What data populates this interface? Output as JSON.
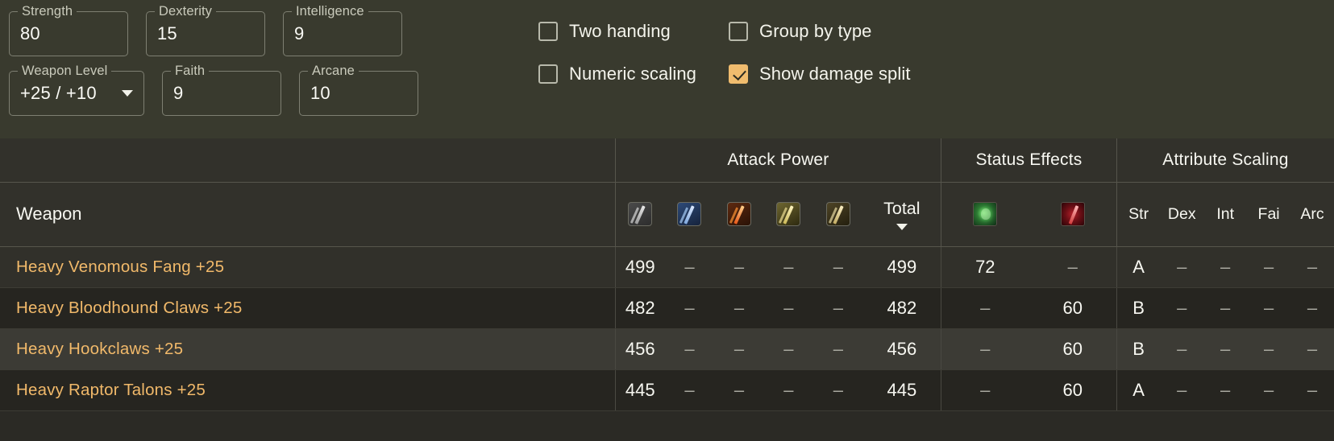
{
  "controls": {
    "fields": [
      {
        "name": "strength",
        "label": "Strength",
        "value": "80",
        "dropdown": false
      },
      {
        "name": "dexterity",
        "label": "Dexterity",
        "value": "15",
        "dropdown": false
      },
      {
        "name": "intelligence",
        "label": "Intelligence",
        "value": "9",
        "dropdown": false
      },
      {
        "name": "weapon-level",
        "label": "Weapon Level",
        "value": "+25 / +10",
        "dropdown": true
      },
      {
        "name": "faith",
        "label": "Faith",
        "value": "9",
        "dropdown": false
      },
      {
        "name": "arcane",
        "label": "Arcane",
        "value": "10",
        "dropdown": false
      }
    ],
    "checkboxes": [
      {
        "name": "two-handing",
        "label": "Two handing",
        "checked": false
      },
      {
        "name": "group-by-type",
        "label": "Group by type",
        "checked": false
      },
      {
        "name": "numeric-scaling",
        "label": "Numeric scaling",
        "checked": false
      },
      {
        "name": "show-damage-split",
        "label": "Show damage split",
        "checked": true
      }
    ],
    "accent_color": "#f0bc6e"
  },
  "table": {
    "group_headers": {
      "attack_power": "Attack Power",
      "status_effects": "Status Effects",
      "attribute_scaling": "Attribute Scaling"
    },
    "weapon_column_label": "Weapon",
    "total_label": "Total",
    "sort_indicator": "descending",
    "damage_icons": [
      {
        "name": "physical-damage-icon",
        "class": "ic-phys"
      },
      {
        "name": "magic-damage-icon",
        "class": "ic-magic"
      },
      {
        "name": "fire-damage-icon",
        "class": "ic-fire"
      },
      {
        "name": "lightning-damage-icon",
        "class": "ic-light"
      },
      {
        "name": "holy-damage-icon",
        "class": "ic-holy"
      }
    ],
    "status_icons": [
      {
        "name": "poison-status-icon",
        "class": "st-poison"
      },
      {
        "name": "bleed-status-icon",
        "class": "st-bleed"
      }
    ],
    "attribute_headers": [
      "Str",
      "Dex",
      "Int",
      "Fai",
      "Arc"
    ],
    "dash": "–",
    "rows": [
      {
        "weapon": "Heavy Venomous Fang +25",
        "damage": [
          "499",
          "–",
          "–",
          "–",
          "–"
        ],
        "total": "499",
        "status": [
          "72",
          "–"
        ],
        "scaling": [
          "A",
          "–",
          "–",
          "–",
          "–"
        ],
        "highlight": false
      },
      {
        "weapon": "Heavy Bloodhound Claws +25",
        "damage": [
          "482",
          "–",
          "–",
          "–",
          "–"
        ],
        "total": "482",
        "status": [
          "–",
          "60"
        ],
        "scaling": [
          "B",
          "–",
          "–",
          "–",
          "–"
        ],
        "highlight": false
      },
      {
        "weapon": "Heavy Hookclaws +25",
        "damage": [
          "456",
          "–",
          "–",
          "–",
          "–"
        ],
        "total": "456",
        "status": [
          "–",
          "60"
        ],
        "scaling": [
          "B",
          "–",
          "–",
          "–",
          "–"
        ],
        "highlight": true
      },
      {
        "weapon": "Heavy Raptor Talons +25",
        "damage": [
          "445",
          "–",
          "–",
          "–",
          "–"
        ],
        "total": "445",
        "status": [
          "–",
          "60"
        ],
        "scaling": [
          "A",
          "–",
          "–",
          "–",
          "–"
        ],
        "highlight": false
      }
    ]
  }
}
